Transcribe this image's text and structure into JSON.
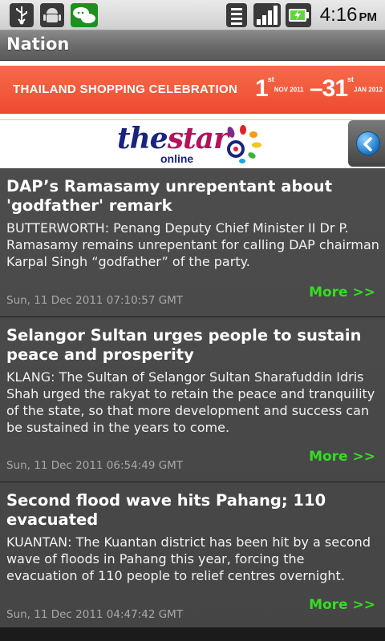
{
  "status_bar": {
    "time": "4:16",
    "ampm": "PM",
    "icons": [
      "usb-icon",
      "android-debug-icon",
      "chat-notification-icon",
      "wifi-icon",
      "signal-icon",
      "battery-charging-icon"
    ]
  },
  "app": {
    "title": "Nation"
  },
  "banner": {
    "text": "THAILAND SHOPPING CELEBRATION",
    "date_start_day": "1",
    "date_start_suffix": "st",
    "date_start_month": "NOV 2011",
    "date_end_day": "31",
    "date_end_suffix": "st",
    "date_end_month": "JAN 2012",
    "brand_color": "#ee4a2e"
  },
  "logo": {
    "part1": "the",
    "part2": "star",
    "sub": "online"
  },
  "articles": [
    {
      "headline": "DAP’s Ramasamy unrepentant about 'godfather' remark",
      "summary": "BUTTERWORTH: Penang Deputy Chief Minister II Dr P. Ramasamy remains unrepentant for calling DAP chairman Karpal Singh “godfather” of the party.",
      "more": "More >>",
      "timestamp": "Sun, 11 Dec 2011 07:10:57 GMT"
    },
    {
      "headline": "Selangor Sultan urges people to sustain peace and prosperity",
      "summary": "KLANG: The Sultan of Selangor Sultan Sharafuddin Idris Shah urged the rakyat to retain the peace and tranquility of the state, so that more development and success can be sustained in the years to come.",
      "more": "More >>",
      "timestamp": "Sun, 11 Dec 2011 06:54:49 GMT"
    },
    {
      "headline": "Second flood wave hits Pahang; 110 evacuated",
      "summary": "KUANTAN: The Kuantan district has been hit by a second wave of floods in Pahang this year, forcing the evacuation of 110 people to relief centres overnight.",
      "more": "More >>",
      "timestamp": "Sun, 11 Dec 2011 04:47:42 GMT"
    }
  ],
  "colors": {
    "more_link": "#33dd22",
    "accent_blue": "#1a74c7"
  }
}
